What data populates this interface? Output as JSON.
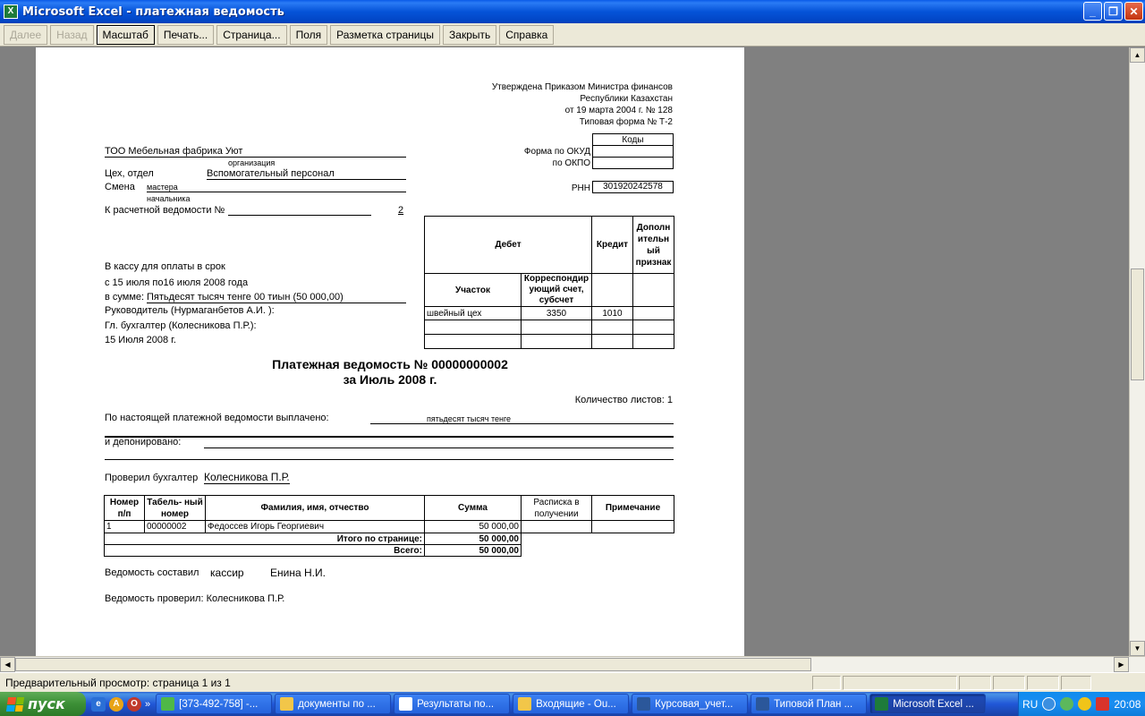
{
  "window": {
    "title": "Microsoft Excel - платежная ведомость",
    "app_icon": "X"
  },
  "toolbar": {
    "buttons": [
      {
        "label": "Далее",
        "enabled": false,
        "name": "next-button"
      },
      {
        "label": "Назад",
        "enabled": false,
        "name": "back-button"
      },
      {
        "label": "Масштаб",
        "enabled": true,
        "pressed": true,
        "name": "zoom-button"
      },
      {
        "label": "Печать...",
        "enabled": true,
        "name": "print-button"
      },
      {
        "label": "Страница...",
        "enabled": true,
        "name": "page-setup-button"
      },
      {
        "label": "Поля",
        "enabled": true,
        "name": "margins-button"
      },
      {
        "label": "Разметка страницы",
        "enabled": true,
        "name": "page-break-preview-button"
      },
      {
        "label": "Закрыть",
        "enabled": true,
        "name": "close-preview-button"
      },
      {
        "label": "Справка",
        "enabled": true,
        "name": "help-button"
      }
    ]
  },
  "document": {
    "approval": [
      "Утверждена Приказом Министра финансов",
      "Республики Казахстан",
      "от 19 марта 2004 г. № 128",
      "Типовая форма № Т-2"
    ],
    "codes_header": "Коды",
    "okud_label": "Форма по ОКУД",
    "okpo_label": "по ОКПО",
    "rnn_label": "РНН",
    "rnn_value": "301920242578",
    "org_name": "ТОО Мебельная фабрика Уют",
    "org_caption": "организация",
    "dept_label": "Цех, отдел",
    "dept_value": "Вспомогательный персонал",
    "shift_label": "Смена",
    "shift_master": "мастера",
    "shift_chief": "начальника",
    "calc_label": "К расчетной ведомости №",
    "calc_value": "2",
    "debet_header": "Дебет",
    "credit_header": "Кредит",
    "extra_header": "Дополн ительн ый признак",
    "section_header": "Участок",
    "corr_header": "Корреспондир ующий счет, субсчет",
    "section_value": "швейный цех",
    "corr_value": "3350",
    "credit_value": "1010",
    "cash_label": "В кассу для оплаты в срок",
    "period": "с  15 июля по16 июля 2008 года",
    "sum_label": "в сумме:",
    "sum_value": "Пятьдесят тысяч тенге 00 тиын (50 000,00)",
    "head_label": "Руководитель (Нурмаганбетов А.И. ):",
    "accountant_label": "Гл. бухгалтер (Колесникова П.Р.):",
    "date": "15 Июля 2008 г.",
    "title_line1": "Платежная ведомость № 00000000002",
    "title_line2": "за Июль 2008 г.",
    "sheets": "Количество листов: 1",
    "paid_label": "По настоящей платежной ведомости выплачено:",
    "paid_value": "пятьдесят тысяч тенге",
    "deposited_label": "и депонировано:",
    "checked_label": "Проверил бухгалтер",
    "checked_value": "Колесникова П.Р.",
    "table_headers": [
      "Номер п/п",
      "Табель- ный номер",
      "Фамилия, имя, отчество",
      "Сумма",
      "Расписка в получении",
      "Примечание"
    ],
    "table_rows": [
      {
        "num": "1",
        "tab": "00000002",
        "name": "Федоссев Игорь Георгиевич",
        "sum": "50 000,00",
        "receipt": "",
        "note": ""
      }
    ],
    "page_total_label": "Итого по странице:",
    "page_total_value": "50 000,00",
    "total_label": "Всего:",
    "total_value": "50 000,00",
    "composed_label": "Ведомость составил",
    "composed_role": "кассир",
    "composed_name": "Енина Н.И.",
    "verified_label": "Ведомость проверил: Колесникова П.Р."
  },
  "status": {
    "text": "Предварительный просмотр: страница 1 из 1"
  },
  "taskbar": {
    "start_label": "пуск",
    "tasks": [
      {
        "label": "[373-492-758] -...",
        "icon_color": "#4fb848"
      },
      {
        "label": "документы по ...",
        "icon_color": "#f2c649"
      },
      {
        "label": "Результаты по...",
        "icon_color": "#ffffff"
      },
      {
        "label": "Входящие - Ou...",
        "icon_color": "#f2c649"
      },
      {
        "label": "Курсовая_учет...",
        "icon_color": "#2b579a"
      },
      {
        "label": "Типовой План ...",
        "icon_color": "#2b579a"
      },
      {
        "label": "Microsoft Excel ...",
        "icon_color": "#1e7b3a"
      }
    ],
    "lang": "RU",
    "clock": "20:08"
  }
}
